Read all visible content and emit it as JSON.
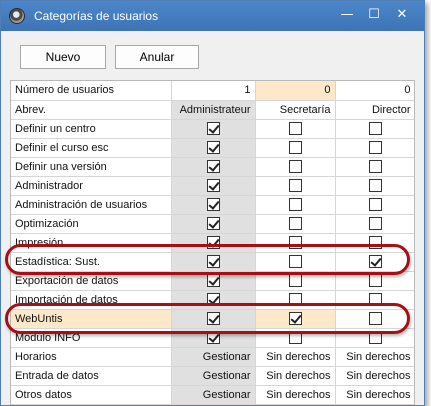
{
  "window": {
    "title": "Categorías de usuarios",
    "controls": {
      "minimize": "—",
      "maximize": "☐",
      "close": "✕"
    }
  },
  "toolbar": {
    "new_label": "Nuevo",
    "cancel_label": "Anular"
  },
  "grid": {
    "count_row": {
      "label": "Número de usuarios",
      "values": [
        "1",
        "0",
        "0"
      ]
    },
    "header_row": {
      "label": "Abrev.",
      "values": [
        "Administrateur",
        "Secretaría",
        "Director"
      ]
    },
    "permission_rows": [
      {
        "label": "Definir un centro",
        "checks": [
          true,
          false,
          false
        ]
      },
      {
        "label": "Definir el curso esc",
        "checks": [
          true,
          false,
          false
        ]
      },
      {
        "label": "Definir una versión",
        "checks": [
          true,
          false,
          false
        ]
      },
      {
        "label": "Administrador",
        "checks": [
          true,
          false,
          false
        ]
      },
      {
        "label": "Administración de usuarios",
        "checks": [
          true,
          false,
          false
        ]
      },
      {
        "label": "Optimización",
        "checks": [
          true,
          false,
          false
        ]
      },
      {
        "label": "Impresión",
        "checks": [
          true,
          false,
          false
        ]
      },
      {
        "label": "Estadística: Sust.",
        "checks": [
          true,
          false,
          true
        ]
      },
      {
        "label": "Exportación de datos",
        "checks": [
          true,
          false,
          false
        ]
      },
      {
        "label": "Importación de datos",
        "checks": [
          true,
          false,
          false
        ]
      },
      {
        "label": "WebUntis",
        "checks": [
          true,
          true,
          false
        ]
      },
      {
        "label": "Módulo INFO",
        "checks": [
          true,
          false,
          false
        ]
      }
    ],
    "rights_rows": [
      {
        "label": "Horarios",
        "values": [
          "Gestionar",
          "Sin derechos",
          "Sin derechos"
        ]
      },
      {
        "label": "Entrada de datos",
        "values": [
          "Gestionar",
          "Sin derechos",
          "Sin derechos"
        ]
      },
      {
        "label": "Otros datos",
        "values": [
          "Gestionar",
          "Sin derechos",
          "Sin derechos"
        ]
      }
    ]
  },
  "annotations": {
    "highlight_color": "#a80f14",
    "highlighted_rows": [
      "Estadística: Sust.",
      "WebUntis"
    ]
  }
}
